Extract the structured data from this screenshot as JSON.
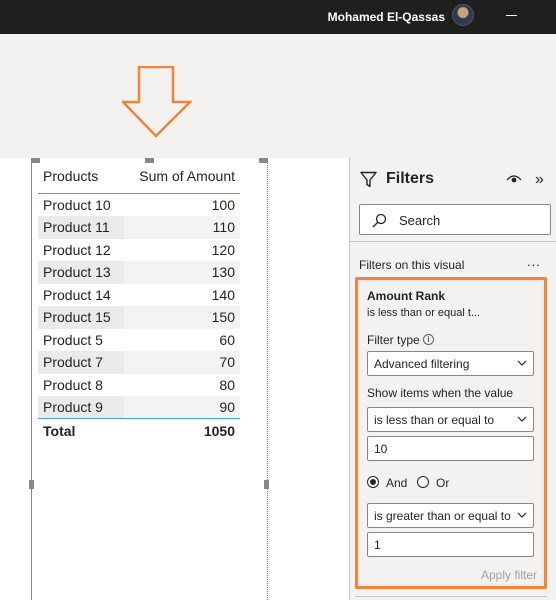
{
  "titlebar": {
    "user_name": "Mohamed El-Qassas"
  },
  "colors": {
    "accent_orange": "#f0843a",
    "table_rule": "#48a9c5",
    "titlebar": "#1f1f1f"
  },
  "table": {
    "columns": [
      "Products",
      "Sum of Amount"
    ],
    "rows": [
      {
        "product": "Product 10",
        "amount": "100"
      },
      {
        "product": "Product 11",
        "amount": "110"
      },
      {
        "product": "Product 12",
        "amount": "120"
      },
      {
        "product": "Product 13",
        "amount": "130"
      },
      {
        "product": "Product 14",
        "amount": "140"
      },
      {
        "product": "Product 15",
        "amount": "150"
      },
      {
        "product": "Product 5",
        "amount": "60"
      },
      {
        "product": "Product 7",
        "amount": "70"
      },
      {
        "product": "Product 8",
        "amount": "80"
      },
      {
        "product": "Product 9",
        "amount": "90"
      }
    ],
    "total": {
      "label": "Total",
      "amount": "1050"
    }
  },
  "filters": {
    "title": "Filters",
    "search_placeholder": "Search",
    "section_label": "Filters on this visual",
    "more": "...",
    "card": {
      "title": "Amount Rank",
      "summary": "is less than or equal t...",
      "filter_type_label": "Filter type",
      "filter_type_value": "Advanced filtering",
      "show_items_label": "Show items when the value",
      "condition1": "is less than or equal to",
      "value1": "10",
      "and_label": "And",
      "or_label": "Or",
      "logic_selected": "And",
      "condition2": "is greater than or equal to",
      "value2": "1",
      "apply_label": "Apply filter"
    }
  },
  "icons": [
    "minimize-icon",
    "down-arrow-icon",
    "funnel-icon",
    "eye-icon",
    "collapse-icon",
    "search-icon",
    "info-icon",
    "chevron-down-icon"
  ]
}
